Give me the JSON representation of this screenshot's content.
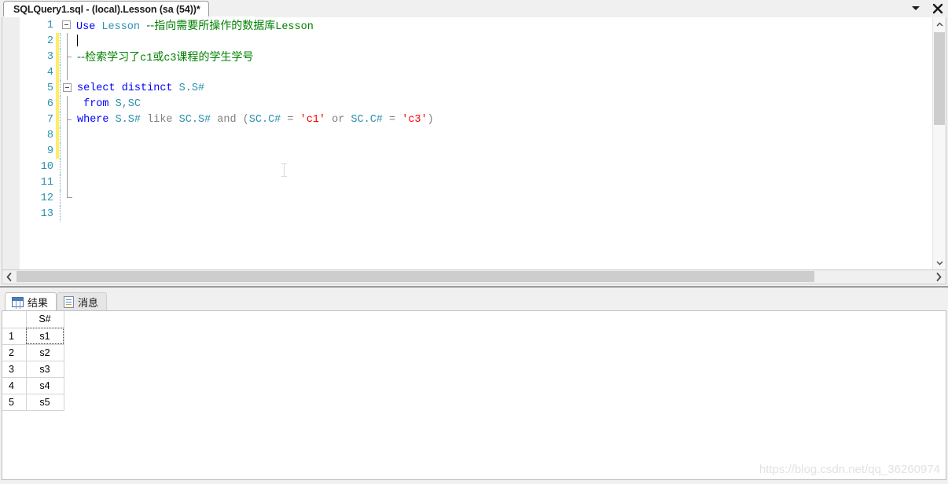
{
  "window": {
    "title": "SQLQuery1.sql - (local).Lesson (sa (54))*",
    "chevron_icon": "chevron-down-icon",
    "close_icon": "close-icon"
  },
  "editor": {
    "lines": [
      {
        "no": "1",
        "changed": false,
        "fold": "open-box",
        "guide": false,
        "segments": [
          {
            "text": "Use ",
            "cls": "kw"
          },
          {
            "text": "Lesson ",
            "cls": "teal"
          },
          {
            "text": "--指向需要所操作的数据库",
            "cls": "comment cjk"
          },
          {
            "text": "Lesson",
            "cls": "comment"
          }
        ]
      },
      {
        "no": "2",
        "changed": true,
        "fold": "line",
        "guide": true,
        "caret": true,
        "segments": []
      },
      {
        "no": "3",
        "changed": true,
        "fold": "tick",
        "guide": true,
        "segments": [
          {
            "text": "--检索学习了",
            "cls": "comment cjk"
          },
          {
            "text": "c1",
            "cls": "comment"
          },
          {
            "text": "或",
            "cls": "comment cjk"
          },
          {
            "text": "c3",
            "cls": "comment"
          },
          {
            "text": "课程的学生学号",
            "cls": "comment cjk"
          }
        ]
      },
      {
        "no": "4",
        "changed": true,
        "fold": "line",
        "guide": true,
        "segments": []
      },
      {
        "no": "5",
        "changed": true,
        "fold": "open-box",
        "guide": true,
        "segments": [
          {
            "text": "select ",
            "cls": "kw"
          },
          {
            "text": "distinct ",
            "cls": "kw"
          },
          {
            "text": "S.S#",
            "cls": "teal"
          }
        ]
      },
      {
        "no": "6",
        "changed": true,
        "fold": "line",
        "guide": true,
        "segments": [
          {
            "text": " from ",
            "cls": "kw"
          },
          {
            "text": "S,SC",
            "cls": "teal"
          }
        ]
      },
      {
        "no": "7",
        "changed": true,
        "fold": "tick",
        "guide": true,
        "segments": [
          {
            "text": "where ",
            "cls": "kw"
          },
          {
            "text": "S.S# ",
            "cls": "teal"
          },
          {
            "text": "like ",
            "cls": "ident"
          },
          {
            "text": "SC.S# ",
            "cls": "teal"
          },
          {
            "text": "and ",
            "cls": "ident"
          },
          {
            "text": "(",
            "cls": "ident"
          },
          {
            "text": "SC.C#",
            "cls": "teal"
          },
          {
            "text": " = ",
            "cls": "ident"
          },
          {
            "text": "'c1'",
            "cls": "str"
          },
          {
            "text": " or ",
            "cls": "ident"
          },
          {
            "text": "SC.C#",
            "cls": "teal"
          },
          {
            "text": " = ",
            "cls": "ident"
          },
          {
            "text": "'c3'",
            "cls": "str"
          },
          {
            "text": ")",
            "cls": "ident"
          }
        ]
      },
      {
        "no": "8",
        "changed": true,
        "fold": "line",
        "guide": true,
        "segments": []
      },
      {
        "no": "9",
        "changed": true,
        "fold": "line",
        "guide": true,
        "segments": []
      },
      {
        "no": "10",
        "changed": false,
        "fold": "line",
        "guide": true,
        "segments": []
      },
      {
        "no": "11",
        "changed": false,
        "fold": "line",
        "guide": true,
        "segments": []
      },
      {
        "no": "12",
        "changed": false,
        "fold": "end",
        "guide": true,
        "segments": []
      },
      {
        "no": "13",
        "changed": false,
        "fold": "none",
        "guide": true,
        "segments": []
      }
    ]
  },
  "scrollbars": {
    "v_up_icon": "chevron-up-icon",
    "v_down_icon": "chevron-down-icon",
    "h_left_icon": "chevron-left-icon",
    "h_right_icon": "chevron-right-icon"
  },
  "results": {
    "tabs": [
      {
        "label": "结果",
        "icon": "results-grid-icon",
        "active": true
      },
      {
        "label": "消息",
        "icon": "messages-doc-icon",
        "active": false
      }
    ],
    "grid": {
      "columns": [
        "S#"
      ],
      "rows": [
        {
          "num": "1",
          "values": [
            "s1"
          ],
          "selected": true
        },
        {
          "num": "2",
          "values": [
            "s2"
          ],
          "selected": false
        },
        {
          "num": "3",
          "values": [
            "s3"
          ],
          "selected": false
        },
        {
          "num": "4",
          "values": [
            "s4"
          ],
          "selected": false
        },
        {
          "num": "5",
          "values": [
            "s5"
          ],
          "selected": false
        }
      ]
    }
  },
  "watermark": {
    "text": "https://blog.csdn.net/qq_36260974"
  }
}
